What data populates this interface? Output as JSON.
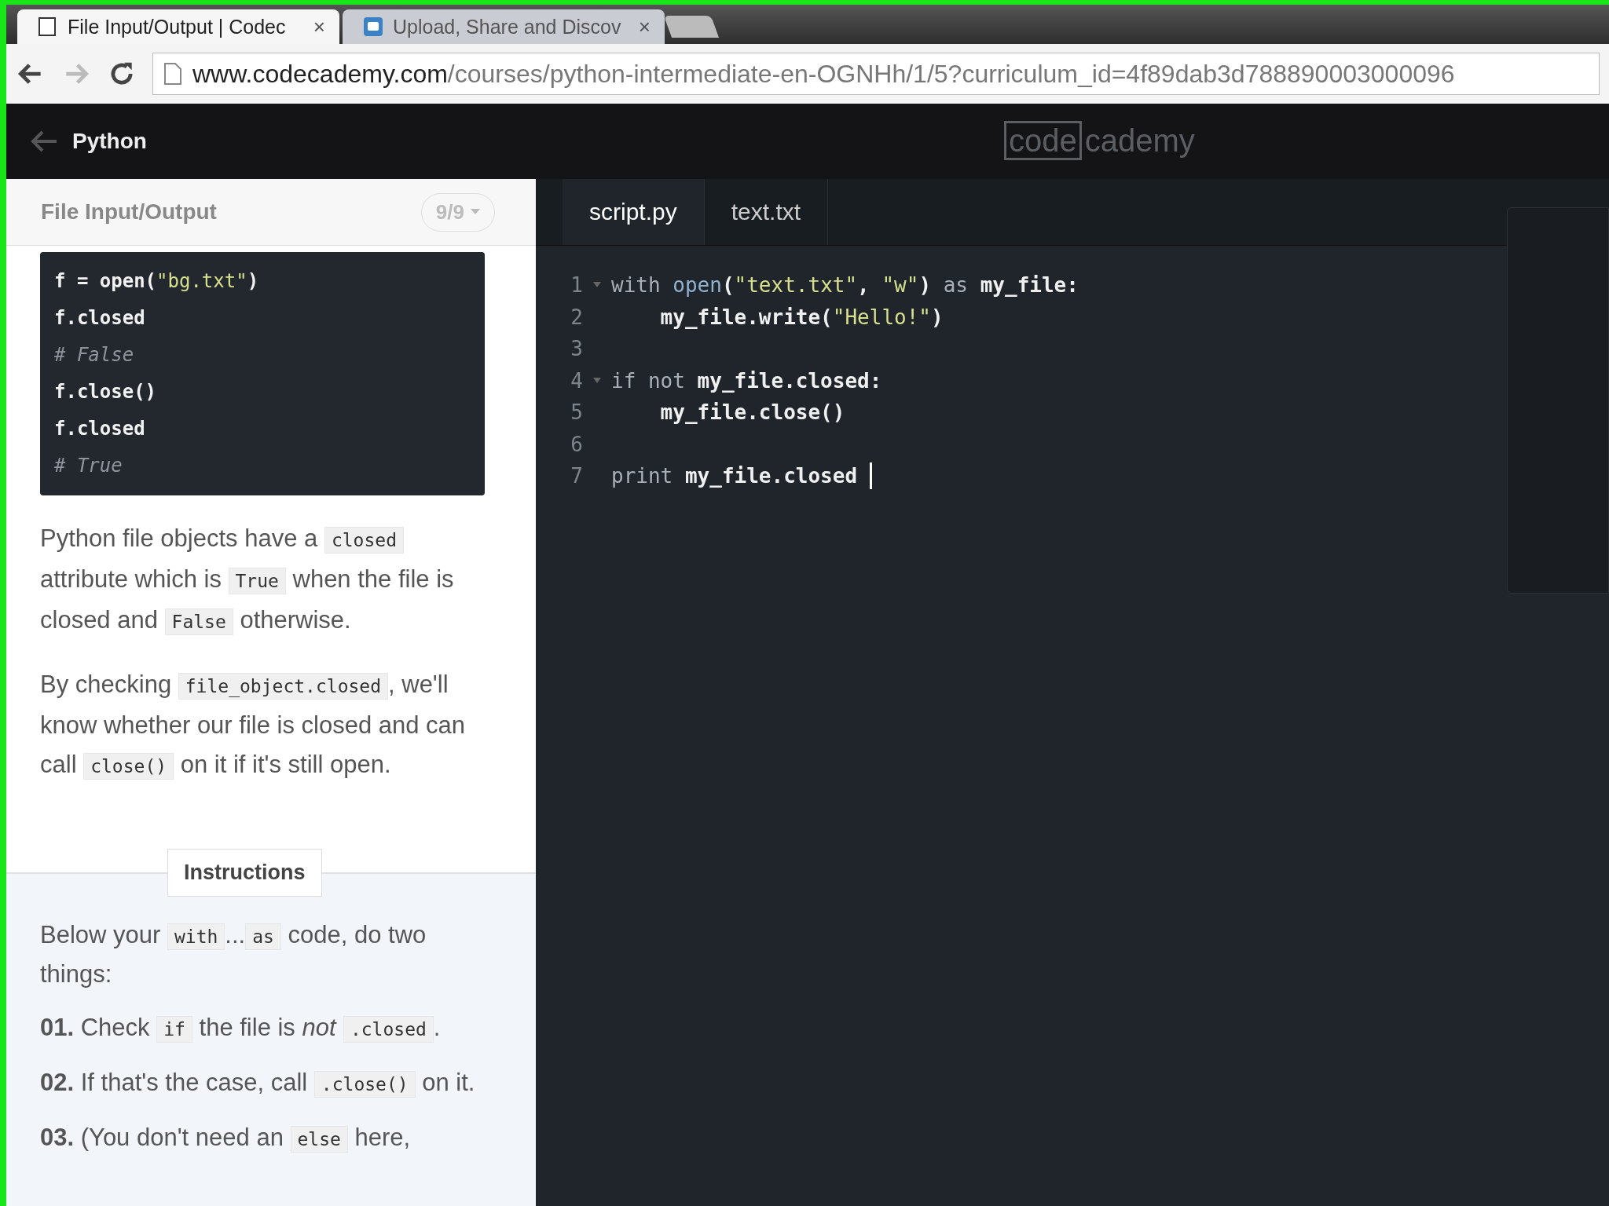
{
  "browser": {
    "tabs": [
      {
        "title": "File Input/Output | Codec",
        "close": "×",
        "selected": true
      },
      {
        "title": "Upload, Share and Discov",
        "close": "×",
        "selected": false
      }
    ],
    "address": {
      "host": "www.codecademy.com",
      "path": "/courses/python-intermediate-en-OGNHh/1/5?curriculum_id=4f89dab3d788890003000096"
    }
  },
  "header": {
    "course": "Python",
    "logo": {
      "boxed": "code",
      "rest": "cademy"
    }
  },
  "lesson": {
    "title": "File Input/Output",
    "progress": "9/9",
    "example": [
      [
        {
          "kind": "plain",
          "text": "f = open("
        },
        {
          "kind": "str",
          "text": "\"bg.txt\""
        },
        {
          "kind": "plain",
          "text": ")"
        }
      ],
      [
        {
          "kind": "plain",
          "text": "f.closed"
        }
      ],
      [
        {
          "kind": "comment",
          "text": "# False"
        }
      ],
      [
        {
          "kind": "plain",
          "text": "f.close()"
        }
      ],
      [
        {
          "kind": "plain",
          "text": "f.closed"
        }
      ],
      [
        {
          "kind": "comment",
          "text": "# True"
        }
      ]
    ],
    "paragraphs": [
      [
        {
          "kind": "text",
          "text": "Python file objects have a "
        },
        {
          "kind": "code",
          "text": "closed"
        },
        {
          "kind": "text",
          "text": " attribute which is "
        },
        {
          "kind": "code",
          "text": "True"
        },
        {
          "kind": "text",
          "text": " when the file is closed and "
        },
        {
          "kind": "code",
          "text": "False"
        },
        {
          "kind": "text",
          "text": " otherwise."
        }
      ],
      [
        {
          "kind": "text",
          "text": "By checking "
        },
        {
          "kind": "code",
          "text": "file_object.closed"
        },
        {
          "kind": "text",
          "text": ", we'll know whether our file is closed and can call "
        },
        {
          "kind": "code",
          "text": "close()"
        },
        {
          "kind": "text",
          "text": " on it if it's still open."
        }
      ]
    ],
    "instructions_label": "Instructions",
    "instructions": [
      [
        {
          "kind": "text",
          "text": "Below your "
        },
        {
          "kind": "code",
          "text": "with"
        },
        {
          "kind": "text",
          "text": "..."
        },
        {
          "kind": "code",
          "text": "as"
        },
        {
          "kind": "text",
          "text": " code, do two things:"
        }
      ],
      [
        {
          "kind": "bold",
          "text": "01."
        },
        {
          "kind": "text",
          "text": " Check "
        },
        {
          "kind": "code",
          "text": "if"
        },
        {
          "kind": "text",
          "text": " the file is "
        },
        {
          "kind": "italic",
          "text": "not"
        },
        {
          "kind": "code",
          "text": ".closed"
        },
        {
          "kind": "text",
          "text": "."
        }
      ],
      [
        {
          "kind": "bold",
          "text": "02."
        },
        {
          "kind": "text",
          "text": " If that's the case, call "
        },
        {
          "kind": "code",
          "text": ".close()"
        },
        {
          "kind": "text",
          "text": " on it."
        }
      ],
      [
        {
          "kind": "bold",
          "text": "03."
        },
        {
          "kind": "text",
          "text": " (You don't need an "
        },
        {
          "kind": "code",
          "text": "else"
        },
        {
          "kind": "text",
          "text": " here,"
        }
      ]
    ]
  },
  "editor": {
    "tabs": [
      {
        "label": "script.py",
        "selected": true
      },
      {
        "label": "text.txt",
        "selected": false
      }
    ],
    "lines": [
      {
        "number": "1",
        "fold": true,
        "tokens": [
          {
            "kind": "kw",
            "text": "with "
          },
          {
            "kind": "fn",
            "text": "open"
          },
          {
            "kind": "plain",
            "text": "("
          },
          {
            "kind": "str",
            "text": "\"text.txt\""
          },
          {
            "kind": "plain",
            "text": ", "
          },
          {
            "kind": "str",
            "text": "\"w\""
          },
          {
            "kind": "plain",
            "text": ") "
          },
          {
            "kind": "kw",
            "text": "as "
          },
          {
            "kind": "id",
            "text": "my_file:"
          }
        ]
      },
      {
        "number": "2",
        "fold": false,
        "tokens": [
          {
            "kind": "id",
            "text": "    my_file.write("
          },
          {
            "kind": "str",
            "text": "\"Hello!\""
          },
          {
            "kind": "id",
            "text": ")"
          }
        ]
      },
      {
        "number": "3",
        "fold": false
      },
      {
        "number": "4",
        "fold": true,
        "tokens": [
          {
            "kind": "kw",
            "text": "if not "
          },
          {
            "kind": "id",
            "text": "my_file.closed:"
          }
        ]
      },
      {
        "number": "5",
        "fold": false,
        "tokens": [
          {
            "kind": "id",
            "text": "    my_file.close()"
          }
        ]
      },
      {
        "number": "6",
        "fold": false
      },
      {
        "number": "7",
        "fold": false,
        "cursor": true,
        "tokens": [
          {
            "kind": "kw",
            "text": "print "
          },
          {
            "kind": "id",
            "text": "my_file.closed "
          }
        ]
      }
    ]
  }
}
